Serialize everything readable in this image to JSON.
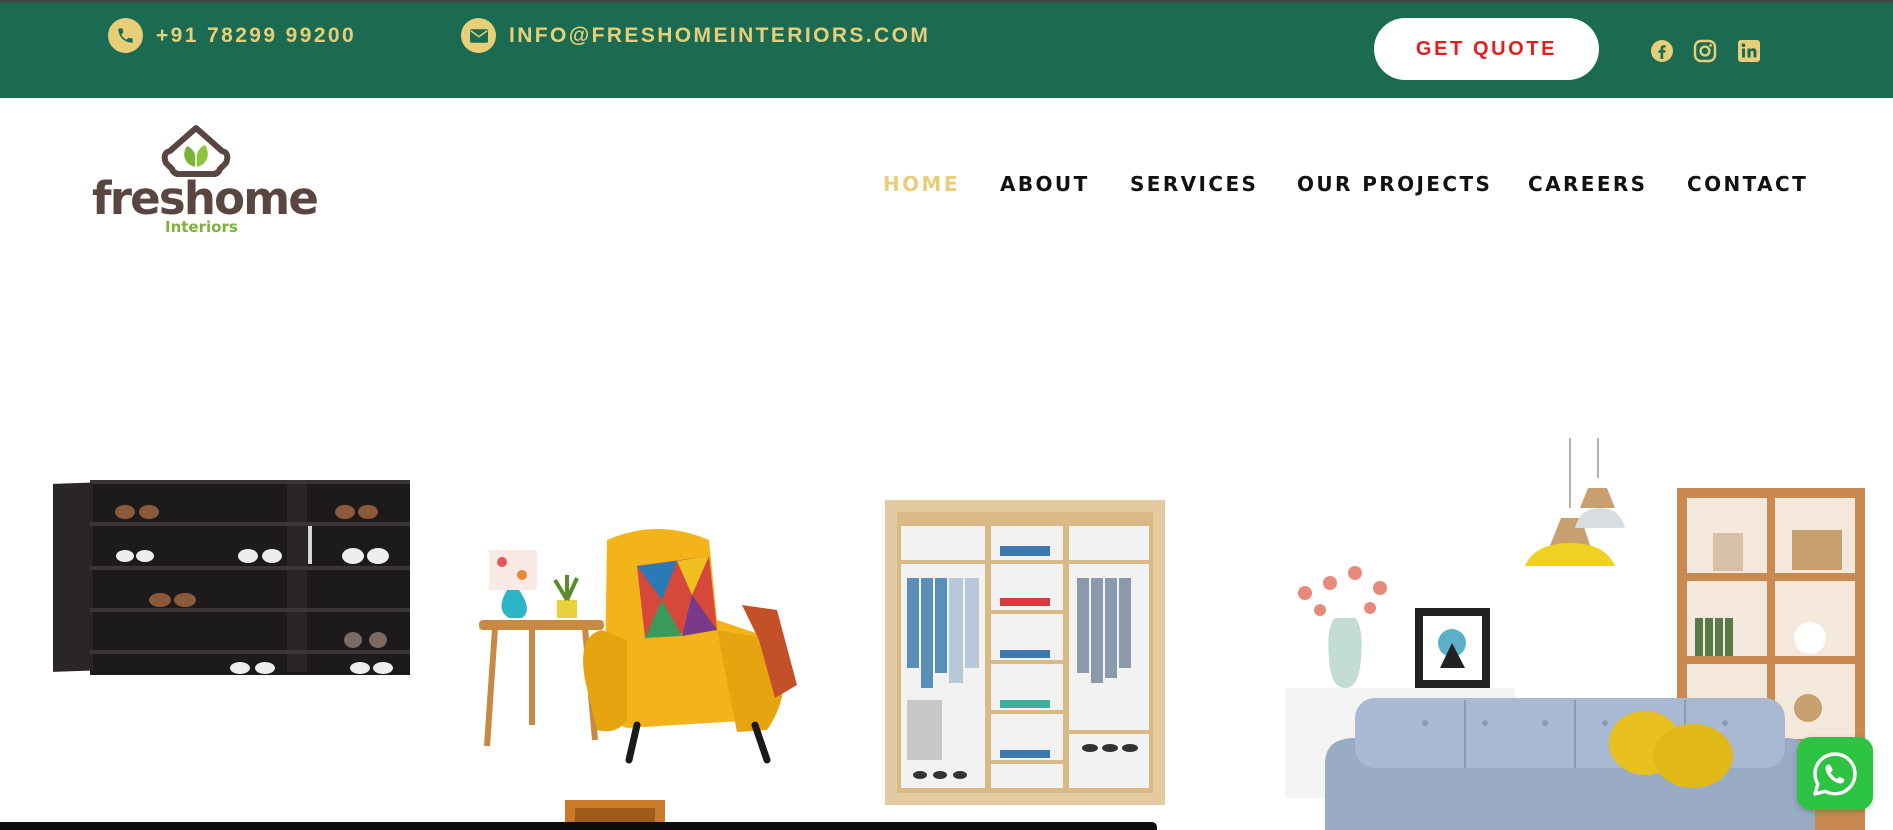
{
  "topbar": {
    "phone": "+91 78299 99200",
    "email": "INFO@FRESHOMEINTERIORS.COM",
    "quote_label": "GET QUOTE",
    "background_color": "#1b6a52",
    "accent_color": "#e7cf79",
    "quote_text_color": "#e0201d",
    "icons": [
      "phone-icon",
      "envelope-icon",
      "facebook-icon",
      "instagram-icon",
      "linkedin-icon"
    ]
  },
  "logo": {
    "word": "freshome",
    "sub": "Interiors",
    "word_color": "#5a4640",
    "leaf_color": "#7cb13a"
  },
  "nav": {
    "items": [
      {
        "label": "HOME",
        "active": true
      },
      {
        "label": "ABOUT",
        "active": false
      },
      {
        "label": "SERVICES",
        "active": false
      },
      {
        "label": "OUR PROJECTS",
        "active": false
      },
      {
        "label": "CAREERS",
        "active": false
      },
      {
        "label": "CONTACT",
        "active": false
      }
    ]
  },
  "hero": {
    "illustrations": [
      "shoe-cabinet-image",
      "yellow-armchair-image",
      "wardrobe-image",
      "living-room-image"
    ]
  },
  "floating": {
    "icon": "whatsapp-icon",
    "color": "#2dc443"
  }
}
